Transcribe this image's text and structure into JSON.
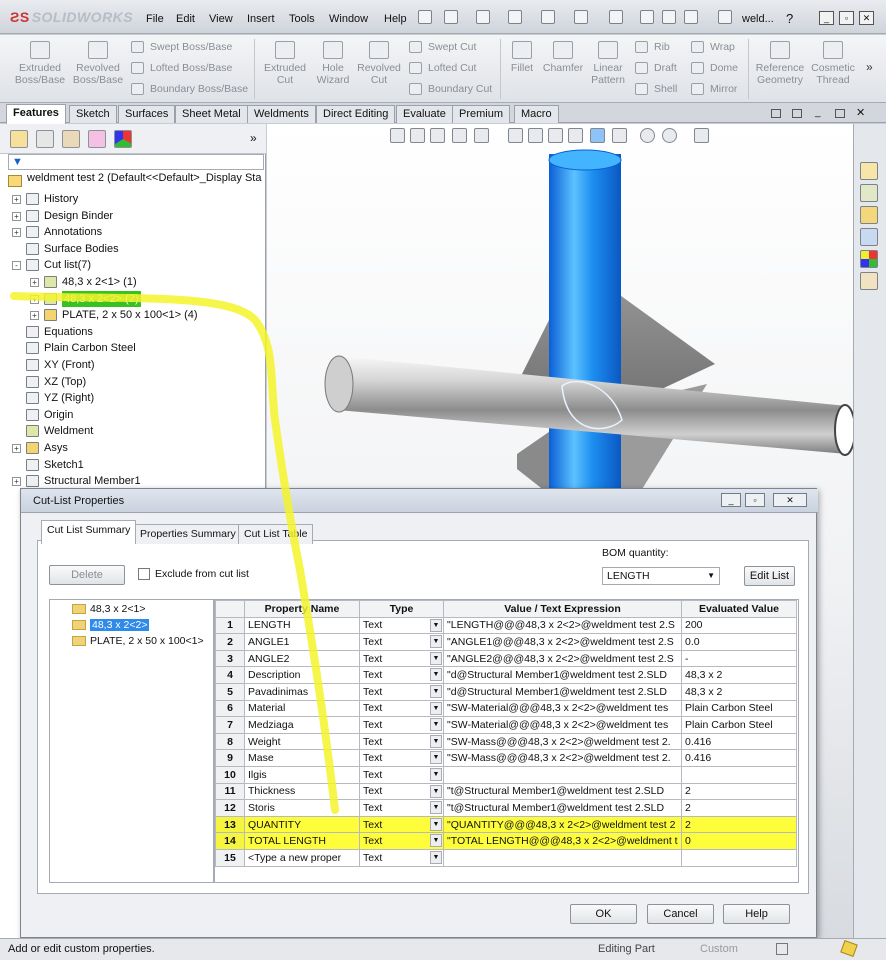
{
  "app": {
    "logo_text": "SOLIDWORKS",
    "window_title": "weld..."
  },
  "menu": [
    "File",
    "Edit",
    "View",
    "Insert",
    "Tools",
    "Window",
    "Help"
  ],
  "ribbon": {
    "big": [
      {
        "label": "Extruded\nBoss/Base",
        "icon": "extrude-icon"
      },
      {
        "label": "Revolved\nBoss/Base",
        "icon": "revolve-icon"
      },
      {
        "label": "Extruded\nCut",
        "icon": "extruded-cut-icon"
      },
      {
        "label": "Hole\nWizard",
        "icon": "hole-wizard-icon"
      },
      {
        "label": "Revolved\nCut",
        "icon": "revolved-cut-icon"
      },
      {
        "label": "Fillet",
        "icon": "fillet-icon"
      },
      {
        "label": "Chamfer",
        "icon": "chamfer-icon"
      },
      {
        "label": "Linear\nPattern",
        "icon": "linear-pattern-icon"
      },
      {
        "label": "Reference\nGeometry",
        "icon": "reference-geometry-icon"
      },
      {
        "label": "Cosmetic\nThread",
        "icon": "cosmetic-thread-icon"
      }
    ],
    "small_boss": [
      "Swept Boss/Base",
      "Lofted Boss/Base",
      "Boundary Boss/Base"
    ],
    "small_cut": [
      "Swept Cut",
      "Lofted Cut",
      "Boundary Cut"
    ],
    "small_features": [
      "Rib",
      "Draft",
      "Shell"
    ],
    "small_features2": [
      "Wrap",
      "Dome",
      "Mirror"
    ]
  },
  "command_tabs": [
    "Features",
    "Sketch",
    "Surfaces",
    "Sheet Metal",
    "Weldments",
    "Direct Editing",
    "Evaluate",
    "Premium",
    "Macro"
  ],
  "tree": {
    "root": "weldment test 2  (Default<<Default>_Display Sta",
    "items": [
      {
        "label": "History",
        "level": 0,
        "exp": "+"
      },
      {
        "label": "Design Binder",
        "level": 0,
        "exp": "+"
      },
      {
        "label": "Annotations",
        "level": 0,
        "exp": "+"
      },
      {
        "label": "Surface Bodies",
        "level": 0,
        "exp": ""
      },
      {
        "label": "Cut list(7)",
        "level": 0,
        "exp": "-"
      },
      {
        "label": "48,3 x 2<1> (1)",
        "level": 1,
        "exp": "+"
      },
      {
        "label": "48,3 x 2<2> (2)",
        "level": 1,
        "exp": "+",
        "selected": true
      },
      {
        "label": "PLATE, 2 x 50 x 100<1> (4)",
        "level": 1,
        "exp": "+"
      },
      {
        "label": "Equations",
        "level": 0,
        "exp": ""
      },
      {
        "label": "Plain Carbon Steel",
        "level": 0,
        "exp": ""
      },
      {
        "label": "XY (Front)",
        "level": 0,
        "exp": ""
      },
      {
        "label": "XZ (Top)",
        "level": 0,
        "exp": ""
      },
      {
        "label": "YZ (Right)",
        "level": 0,
        "exp": ""
      },
      {
        "label": "Origin",
        "level": 0,
        "exp": ""
      },
      {
        "label": "Weldment",
        "level": 0,
        "exp": ""
      },
      {
        "label": "Asys",
        "level": 0,
        "exp": "+"
      },
      {
        "label": "Sketch1",
        "level": 0,
        "exp": ""
      },
      {
        "label": "Structural Member1",
        "level": 0,
        "exp": "+"
      }
    ]
  },
  "dialog": {
    "title": "Cut-List Properties",
    "tabs": [
      "Cut List Summary",
      "Properties Summary",
      "Cut List Table"
    ],
    "delete_label": "Delete",
    "exclude_label": "Exclude from cut list",
    "bom_label": "BOM quantity:",
    "bom_value": "LENGTH",
    "edit_list_label": "Edit List",
    "list_items": [
      "48,3 x 2<1>",
      "48,3 x 2<2>",
      "PLATE, 2 x 50 x 100<1>"
    ],
    "columns": [
      "Property Name",
      "Type",
      "Value / Text Expression",
      "Evaluated Value"
    ],
    "rows": [
      {
        "n": "1",
        "name": "LENGTH",
        "type": "Text",
        "expr": "\"LENGTH@@@48,3 x 2<2>@weldment test 2.S",
        "val": "200"
      },
      {
        "n": "2",
        "name": "ANGLE1",
        "type": "Text",
        "expr": "\"ANGLE1@@@48,3 x 2<2>@weldment test 2.S",
        "val": "0.0"
      },
      {
        "n": "3",
        "name": "ANGLE2",
        "type": "Text",
        "expr": "\"ANGLE2@@@48,3 x 2<2>@weldment test 2.S",
        "val": "-"
      },
      {
        "n": "4",
        "name": "Description",
        "type": "Text",
        "expr": "\"d@Structural Member1@weldment test 2.SLD",
        "val": "48,3 x 2"
      },
      {
        "n": "5",
        "name": "Pavadinimas",
        "type": "Text",
        "expr": "\"d@Structural Member1@weldment test 2.SLD",
        "val": "48,3 x 2"
      },
      {
        "n": "6",
        "name": "Material",
        "type": "Text",
        "expr": "\"SW-Material@@@48,3 x 2<2>@weldment tes",
        "val": "Plain Carbon Steel"
      },
      {
        "n": "7",
        "name": "Medziaga",
        "type": "Text",
        "expr": "\"SW-Material@@@48,3 x 2<2>@weldment tes",
        "val": "Plain Carbon Steel"
      },
      {
        "n": "8",
        "name": "Weight",
        "type": "Text",
        "expr": "\"SW-Mass@@@48,3 x 2<2>@weldment test 2.",
        "val": "0.416"
      },
      {
        "n": "9",
        "name": "Mase",
        "type": "Text",
        "expr": "\"SW-Mass@@@48,3 x 2<2>@weldment test 2.",
        "val": "0.416"
      },
      {
        "n": "10",
        "name": "Ilgis",
        "type": "Text",
        "expr": "",
        "val": ""
      },
      {
        "n": "11",
        "name": "Thickness",
        "type": "Text",
        "expr": "\"t@Structural Member1@weldment test 2.SLD",
        "val": "2"
      },
      {
        "n": "12",
        "name": "Storis",
        "type": "Text",
        "expr": "\"t@Structural Member1@weldment test 2.SLD",
        "val": "2"
      },
      {
        "n": "13",
        "name": "QUANTITY",
        "type": "Text",
        "expr": "\"QUANTITY@@@48,3 x 2<2>@weldment test 2",
        "val": "2",
        "highlight": true
      },
      {
        "n": "14",
        "name": "TOTAL LENGTH",
        "type": "Text",
        "expr": "\"TOTAL LENGTH@@@48,3 x 2<2>@weldment t",
        "val": "0",
        "highlight": true
      },
      {
        "n": "15",
        "name": "<Type a new proper",
        "type": "Text",
        "expr": "",
        "val": ""
      }
    ],
    "ok_label": "OK",
    "cancel_label": "Cancel",
    "help_label": "Help"
  },
  "status": {
    "left": "Add or edit custom properties.",
    "mode": "Editing Part",
    "custom": "Custom"
  },
  "colors": {
    "highlight": "#fdfd3b",
    "tree_select": "#39c11f",
    "list_select": "#2f8bea",
    "pipe_blue": "#1f8ff0"
  }
}
